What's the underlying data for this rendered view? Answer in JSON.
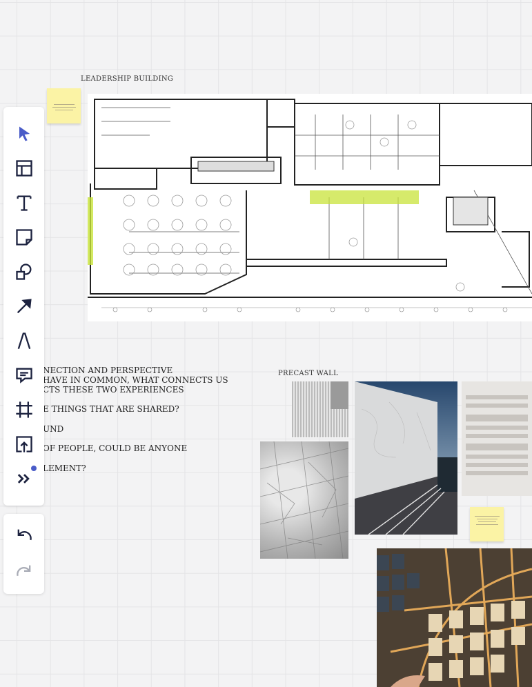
{
  "board": {
    "frames": {
      "leadership_label": "LEADERSHIP BUILDING",
      "precast_label": "PRECAST WALL"
    },
    "notes": {
      "line1": "NECTION AND PERSPECTIVE",
      "line2": "HAVE IN COMMON, WHAT CONNECTS US",
      "line3": "CTS THESE TWO EXPERIENCES",
      "line4": "E THINGS THAT ARE SHARED?",
      "line5": "UND",
      "line6": "OF PEOPLE, COULD BE ANYONE",
      "line7": "LEMENT?"
    },
    "colors": {
      "accent": "#4a5cc8",
      "sticky": "#fbf3a5",
      "highlight": "#c8e33a"
    }
  },
  "toolbar": {
    "tools": [
      {
        "name": "select",
        "icon": "cursor-icon"
      },
      {
        "name": "templates",
        "icon": "layout-icon"
      },
      {
        "name": "text",
        "icon": "text-icon"
      },
      {
        "name": "sticky-note",
        "icon": "sticky-note-icon"
      },
      {
        "name": "shapes",
        "icon": "shapes-icon"
      },
      {
        "name": "connection-line",
        "icon": "arrow-icon"
      },
      {
        "name": "pen",
        "icon": "pen-icon"
      },
      {
        "name": "comment",
        "icon": "comment-icon"
      },
      {
        "name": "frame",
        "icon": "frame-icon"
      },
      {
        "name": "upload",
        "icon": "upload-icon"
      },
      {
        "name": "more",
        "icon": "chevrons-right-icon"
      }
    ],
    "history": [
      {
        "name": "undo",
        "icon": "undo-icon"
      },
      {
        "name": "redo",
        "icon": "redo-icon"
      }
    ]
  }
}
